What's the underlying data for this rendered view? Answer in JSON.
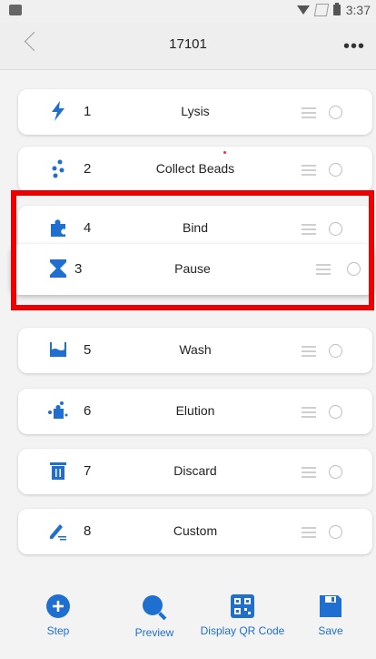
{
  "statusbar": {
    "time": "3:37"
  },
  "header": {
    "title": "17101",
    "more": "•••"
  },
  "steps": [
    {
      "num": "1",
      "label": "Lysis",
      "icon": "bolt-icon"
    },
    {
      "num": "2",
      "label": "Collect Beads",
      "icon": "beads-icon"
    },
    {
      "num": "4",
      "label": "Bind",
      "icon": "puzzle-icon"
    },
    {
      "num": "3",
      "label": "Pause",
      "icon": "hourglass-icon"
    },
    {
      "num": "5",
      "label": "Wash",
      "icon": "wash-icon"
    },
    {
      "num": "6",
      "label": "Elution",
      "icon": "elution-icon"
    },
    {
      "num": "7",
      "label": "Discard",
      "icon": "trash-icon"
    },
    {
      "num": "8",
      "label": "Custom",
      "icon": "pen-icon"
    }
  ],
  "bottom": {
    "step": "Step",
    "preview": "Preview",
    "qr": "Display QR Code",
    "save": "Save"
  },
  "colors": {
    "accent": "#1f6fd1",
    "highlight": "#ee0000"
  }
}
